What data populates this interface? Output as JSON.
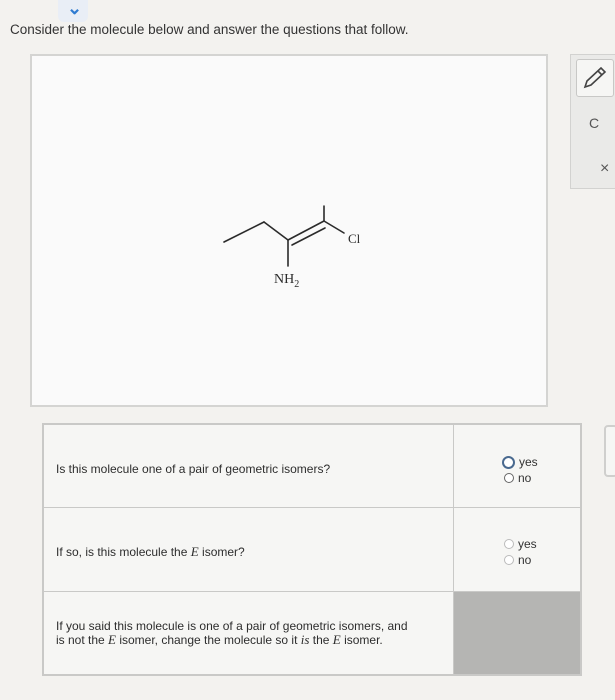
{
  "prompt": "Consider the molecule below and answer the questions that follow.",
  "molecule": {
    "amine_label": "NH",
    "amine_subscript": "2",
    "halogen_label": "Cl"
  },
  "toolbar": {
    "pencil_icon": "pencil-icon",
    "reset_icon": "C",
    "close_icon": "×"
  },
  "questions": [
    {
      "text": "Is this molecule one of a pair of geometric isomers?",
      "options": [
        "yes",
        "no"
      ]
    },
    {
      "text_before": "If so, is this molecule the ",
      "text_var": "E",
      "text_after": " isomer?",
      "options": [
        "yes",
        "no"
      ]
    },
    {
      "line1_before": "If you said this molecule is one of a pair of geometric isomers, and",
      "line2_before": "is not the ",
      "line2_var1": "E",
      "line2_mid": " isomer, change the molecule so it ",
      "line2_is": "is",
      "line2_the": " the ",
      "line2_var2": "E",
      "line2_after": " isomer."
    }
  ]
}
